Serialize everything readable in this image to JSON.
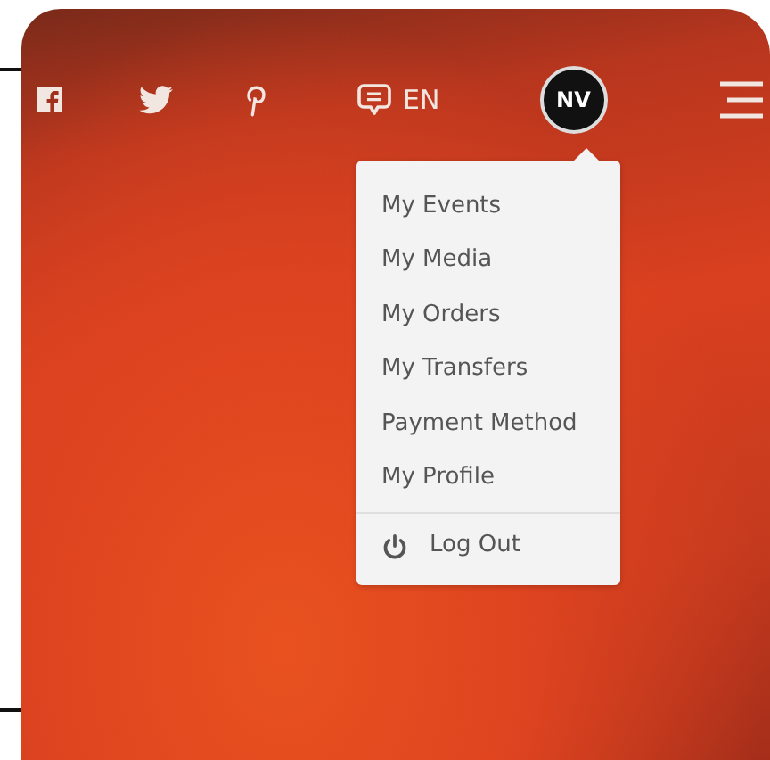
{
  "header": {
    "social": [
      {
        "kind": "facebook"
      },
      {
        "kind": "twitter"
      },
      {
        "kind": "pinterest"
      }
    ],
    "language": "EN",
    "avatar": {
      "initials": "NV"
    }
  },
  "user_menu": {
    "items": [
      {
        "kind": "link",
        "label": "My Events"
      },
      {
        "kind": "link",
        "label": "My Media"
      },
      {
        "kind": "link",
        "label": "My Orders"
      },
      {
        "kind": "link",
        "label": "My Transfers"
      },
      {
        "kind": "link",
        "label": "Payment Method"
      },
      {
        "kind": "link",
        "label": "My Profile"
      },
      {
        "kind": "logout",
        "label": "Log Out"
      }
    ]
  }
}
